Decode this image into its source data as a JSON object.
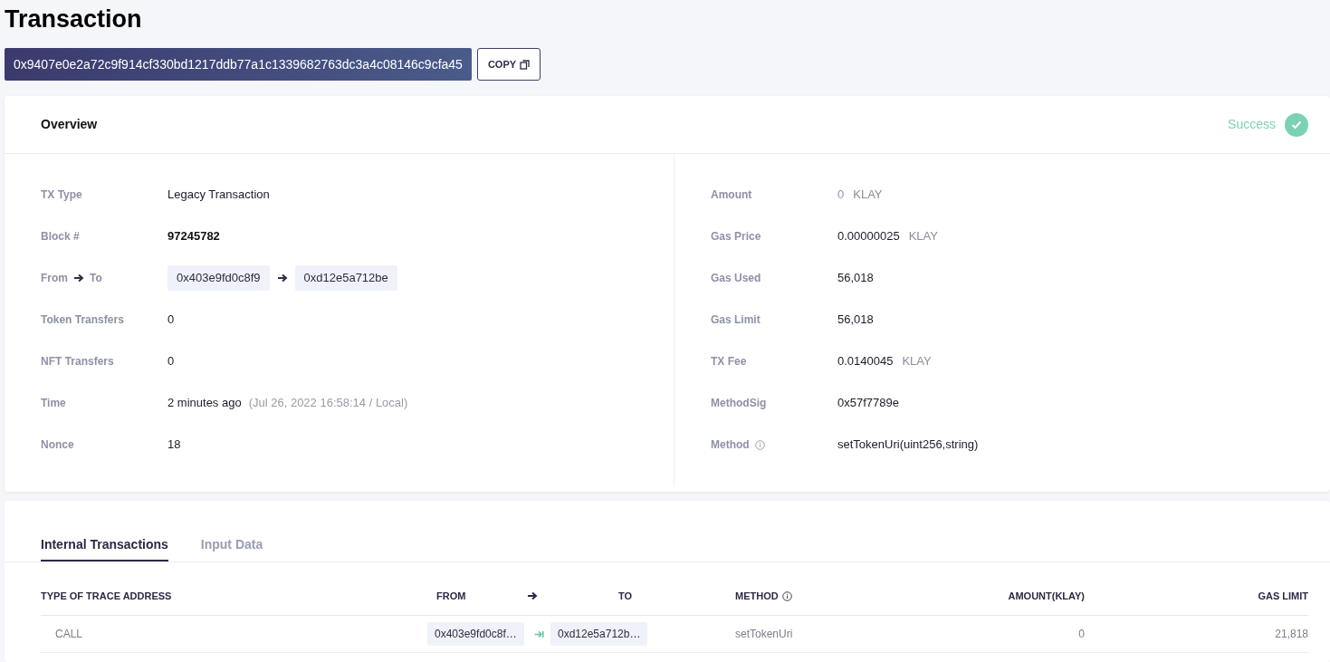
{
  "page_title": "Transaction",
  "hash": {
    "value": "0x9407e0e2a72c9f914cf330bd1217ddb77a1c1339682763dc3a4c08146c9cfa45",
    "copy_label": "COPY"
  },
  "overview": {
    "title": "Overview",
    "status": {
      "label": "Success",
      "kind": "success"
    },
    "left_fields": [
      {
        "label": "TX Type",
        "kind": "plain",
        "value": "Legacy Transaction"
      },
      {
        "label": "Block #",
        "kind": "strong",
        "value": "97245782"
      },
      {
        "labels": [
          "From",
          "To"
        ],
        "kind": "addresses",
        "values": [
          "0x403e9fd0c8f9",
          "0xd12e5a712be"
        ]
      },
      {
        "label": "Token Transfers",
        "kind": "plain",
        "value": "0"
      },
      {
        "label": "NFT Transfers",
        "kind": "plain",
        "value": "0"
      },
      {
        "label": "Time",
        "kind": "plain",
        "value": "2 minutes ago",
        "note": "(Jul 26, 2022 16:58:14 / Local)"
      },
      {
        "label": "Nonce",
        "kind": "plain",
        "value": "18"
      }
    ],
    "right_fields": [
      {
        "label": "Amount",
        "kind": "faint",
        "value": "0",
        "unit": "KLAY"
      },
      {
        "label": "Gas Price",
        "kind": "plain",
        "value": "0.00000025",
        "unit": "KLAY"
      },
      {
        "label": "Gas Used",
        "kind": "plain",
        "value": "56,018"
      },
      {
        "label": "Gas Limit",
        "kind": "plain",
        "value": "56,018"
      },
      {
        "label": "TX Fee",
        "kind": "plain",
        "value": "0.0140045",
        "unit": "KLAY"
      },
      {
        "label": "MethodSig",
        "kind": "plain",
        "value": "0x57f7789e"
      },
      {
        "label": "Method",
        "kind": "plain",
        "value": "setTokenUri(uint256,string)",
        "info_icon": true
      }
    ]
  },
  "tabs": [
    {
      "label": "Internal Transactions",
      "selected": true
    },
    {
      "label": "Input Data",
      "selected": false
    }
  ],
  "table": {
    "columns": [
      "TYPE OF TRACE ADDRESS",
      "FROM",
      "TO",
      "METHOD",
      "AMOUNT(KLAY)",
      "GAS LIMIT"
    ],
    "rows": [
      {
        "type": "CALL",
        "from": "0x403e9fd0c8f…",
        "to": "0xd12e5a712b…",
        "method": "setTokenUri",
        "amount": "0",
        "gas_limit": "21,818"
      }
    ]
  }
}
